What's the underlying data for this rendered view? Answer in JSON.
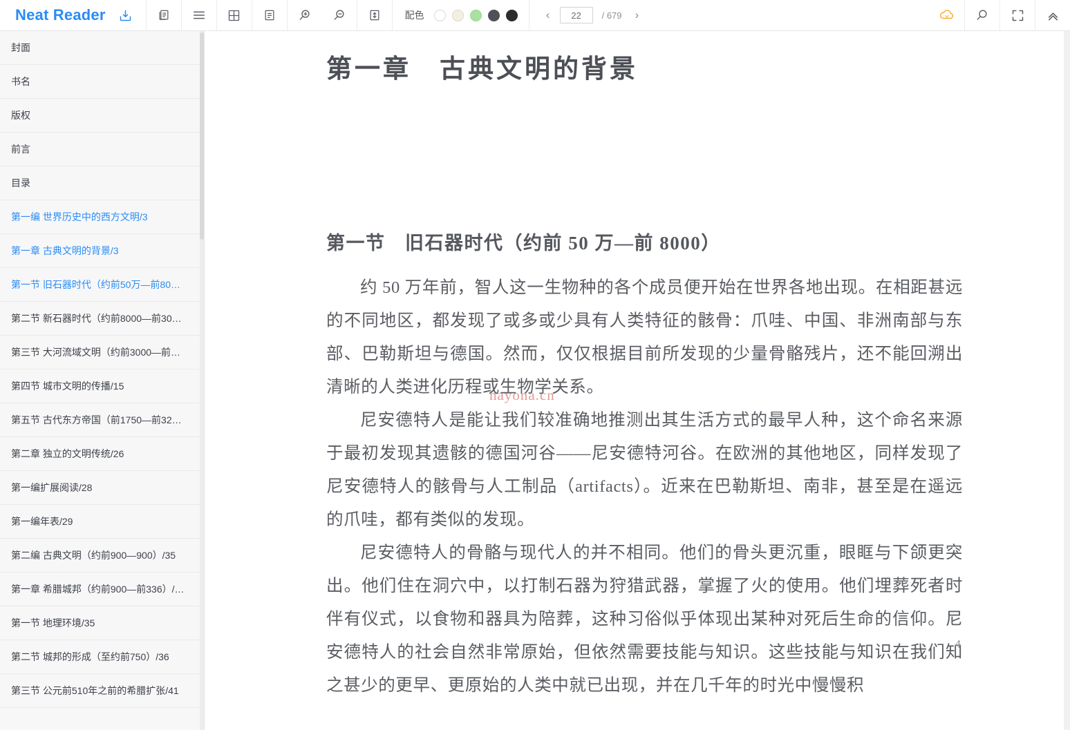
{
  "app": {
    "brand": "Neat Reader"
  },
  "toolbar": {
    "icons": [
      {
        "name": "import-book-icon",
        "title": "导入"
      },
      {
        "name": "two-page-view-icon",
        "title": "双页"
      },
      {
        "name": "menu-icon",
        "title": "目录"
      },
      {
        "name": "grid-view-icon",
        "title": "网格"
      },
      {
        "name": "notes-icon",
        "title": "笔记"
      },
      {
        "name": "zoom-in-icon",
        "title": "放大"
      },
      {
        "name": "zoom-out-icon",
        "title": "缩小"
      },
      {
        "name": "line-height-icon",
        "title": "行距"
      }
    ],
    "scheme_label": "配色",
    "swatches": [
      {
        "name": "scheme-white",
        "color": "#ffffff",
        "border": "#d9dadc",
        "selected": false
      },
      {
        "name": "scheme-sepia",
        "color": "#f3efe2",
        "border": "#ddd8c6",
        "selected": false
      },
      {
        "name": "scheme-green",
        "color": "#a8e2a1",
        "border": "#9ad694",
        "selected": false
      },
      {
        "name": "scheme-gray",
        "color": "#4e5256",
        "border": "#4e5256",
        "selected": false
      },
      {
        "name": "scheme-black",
        "color": "#2b2d2f",
        "border": "#2b2d2f",
        "selected": false
      }
    ],
    "pager": {
      "prev": "‹",
      "next": "›",
      "current_page": "22",
      "total_label": "/ 679"
    },
    "right_icons": [
      {
        "name": "cloud-sync-icon",
        "color": "#f5a623"
      },
      {
        "name": "search-icon",
        "color": "#5a5f66"
      },
      {
        "name": "fullscreen-icon",
        "color": "#5a5f66"
      },
      {
        "name": "collapse-toolbar-icon",
        "color": "#5a5f66"
      }
    ]
  },
  "sidebar": {
    "items": [
      {
        "label": "封面",
        "active": false
      },
      {
        "label": "书名",
        "active": false
      },
      {
        "label": "版权",
        "active": false
      },
      {
        "label": "前言",
        "active": false
      },
      {
        "label": "目录",
        "active": false
      },
      {
        "label": "第一编 世界历史中的西方文明/3",
        "active": true
      },
      {
        "label": "第一章 古典文明的背景/3",
        "active": true
      },
      {
        "label": "第一节 旧石器时代（约前50万—前80…",
        "active": true
      },
      {
        "label": "第二节 新石器时代（约前8000—前30…",
        "active": false
      },
      {
        "label": "第三节 大河流域文明（约前3000—前…",
        "active": false
      },
      {
        "label": "第四节 城市文明的传播/15",
        "active": false
      },
      {
        "label": "第五节 古代东方帝国（前1750—前32…",
        "active": false
      },
      {
        "label": "第二章 独立的文明传统/26",
        "active": false
      },
      {
        "label": "第一编扩展阅读/28",
        "active": false
      },
      {
        "label": "第一编年表/29",
        "active": false
      },
      {
        "label": "第二编 古典文明（约前900—900）/35",
        "active": false
      },
      {
        "label": "第一章 希腊城邦（约前900—前336）/…",
        "active": false
      },
      {
        "label": "第一节 地理环境/35",
        "active": false
      },
      {
        "label": "第二节 城邦的形成（至约前750）/36",
        "active": false
      },
      {
        "label": "第三节 公元前510年之前的希腊扩张/41",
        "active": false
      }
    ]
  },
  "reader": {
    "chapter_title": "第一章　古典文明的背景",
    "section_title": "第一节　旧石器时代（约前 50 万—前 8000）",
    "paragraphs": [
      "约 50 万年前，智人这一生物种的各个成员便开始在世界各地出现。在相距甚远的不同地区，都发现了或多或少具有人类特征的骸骨：爪哇、中国、非洲南部与东部、巴勒斯坦与德国。然而，仅仅根据目前所发现的少量骨骼残片，还不能回溯出清晰的人类进化历程或生物学关系。",
      "尼安德特人是能让我们较准确地推测出其生活方式的最早人种，这个命名来源于最初发现其遗骸的德国河谷——尼安德特河谷。在欧洲的其他地区，同样发现了尼安德特人的骸骨与人工制品（artifacts）。近来在巴勒斯坦、南非，甚至是在遥远的爪哇，都有类似的发现。",
      "尼安德特人的骨骼与现代人的并不相同。他们的骨头更沉重，眼眶与下颌更突出。他们住在洞穴中，以打制石器为狩猎武器，掌握了火的使用。他们埋葬死者时伴有仪式，以食物和器具为陪葬，这种习俗似乎体现出某种对死后生命的信仰。尼安德特人的社会自然非常原始，但依然需要技能与知识。这些技能与知识在我们知之甚少的更早、更原始的人类中就已出现，并在几千年的时光中慢慢积"
    ],
    "watermark": "nayona.cn",
    "page_number": "4"
  }
}
